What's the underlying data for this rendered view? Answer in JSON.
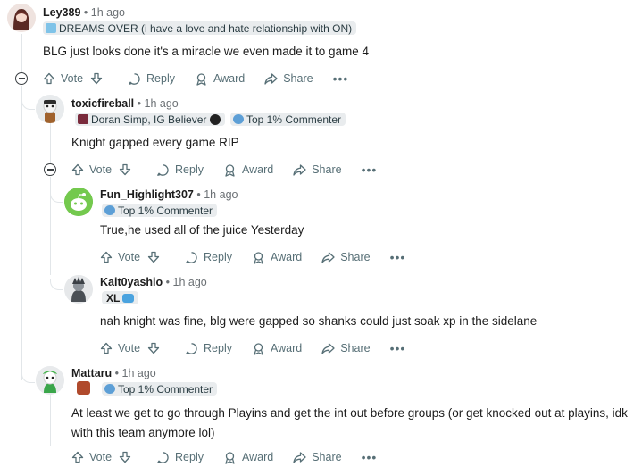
{
  "actions": {
    "vote": "Vote",
    "reply": "Reply",
    "award": "Award",
    "share": "Share",
    "more": "•••"
  },
  "comments": [
    {
      "author": "Ley389",
      "time": "1h ago",
      "flair": "DREAMS OVER (i have a love and hate relationship with ON)",
      "text": "BLG just looks done it's a miracle we even made it to game 4"
    },
    {
      "author": "toxicfireball",
      "time": "1h ago",
      "flair": "Doran Simp, IG Believer",
      "badge": "Top 1% Commenter",
      "text": "Knight gapped every game RIP"
    },
    {
      "author": "Fun_Highlight307",
      "time": "1h ago",
      "badge": "Top 1% Commenter",
      "text": "True,he used all of the juice Yesterday"
    },
    {
      "author": "Kait0yashio",
      "time": "1h ago",
      "flair": "XL",
      "text": "nah knight was fine, blg were gapped so shanks could just soak xp in the sidelane"
    },
    {
      "author": "Mattaru",
      "time": "1h ago",
      "badge": "Top 1% Commenter",
      "text": "At least we get to go through Playins and get the int out before groups (or get knocked out at playins, idk with this team anymore lol)"
    }
  ],
  "separator": "•",
  "colors": {
    "accent": "#0079d3",
    "muted": "#576f76",
    "flair_bg": "#e9ecee"
  }
}
